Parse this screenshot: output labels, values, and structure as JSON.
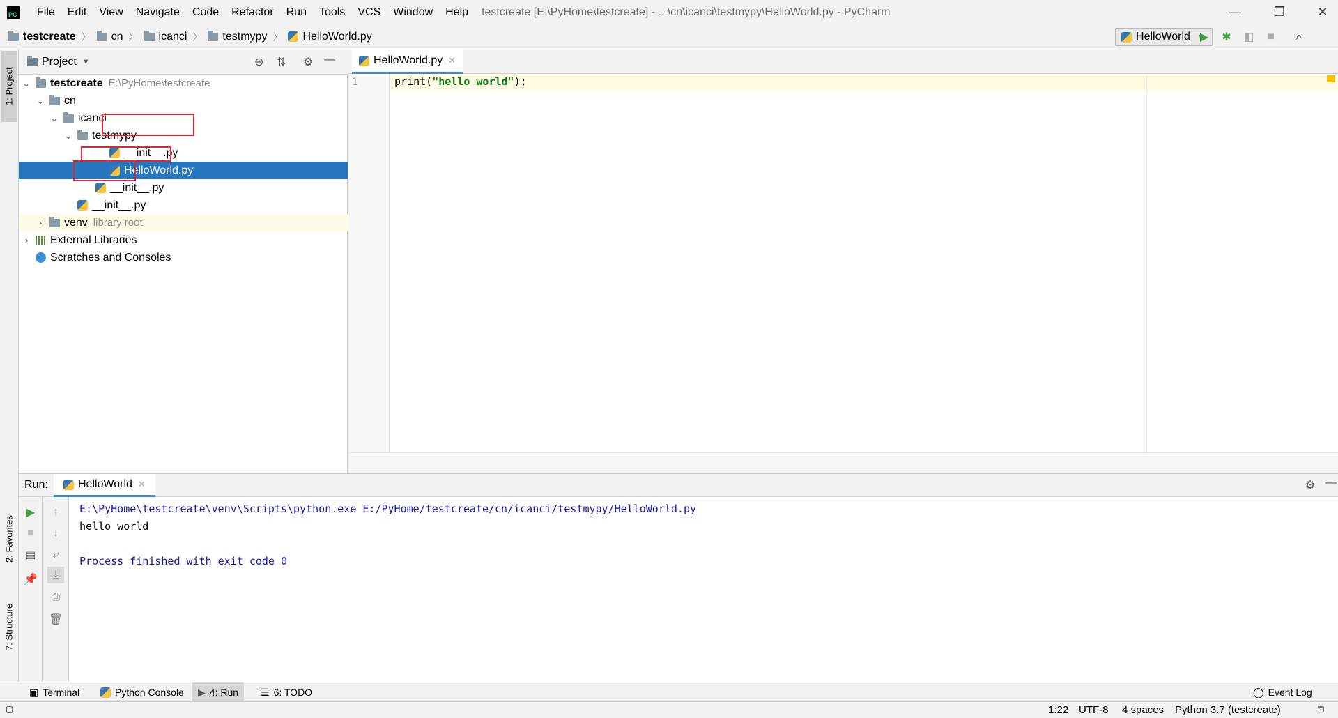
{
  "window": {
    "menu": [
      "File",
      "Edit",
      "View",
      "Navigate",
      "Code",
      "Refactor",
      "Run",
      "Tools",
      "VCS",
      "Window",
      "Help"
    ],
    "title": "testcreate [E:\\PyHome\\testcreate] - ...\\cn\\icanci\\testmypy\\HelloWorld.py - PyCharm",
    "logo_text": "PC"
  },
  "breadcrumb": [
    "testcreate",
    "cn",
    "icanci",
    "testmypy",
    "HelloWorld.py"
  ],
  "run_config": {
    "label": "HelloWorld"
  },
  "left_stripe": {
    "project": "1: Project",
    "favorites": "2: Favorites",
    "structure": "7: Structure"
  },
  "project_panel": {
    "title": "Project",
    "tree": [
      {
        "label": "testcreate",
        "extra": "E:\\PyHome\\testcreate"
      },
      {
        "label": "cn"
      },
      {
        "label": "icanci"
      },
      {
        "label": "testmypy"
      },
      {
        "label": "__init__.py"
      },
      {
        "label": "HelloWorld.py"
      },
      {
        "label": "__init__.py"
      },
      {
        "label": "__init__.py"
      },
      {
        "label": "venv",
        "extra": "library root"
      },
      {
        "label": "External Libraries"
      },
      {
        "label": "Scratches and Consoles"
      }
    ]
  },
  "editor": {
    "tab": "HelloWorld.py",
    "line_number": "1",
    "code_fn": "print(",
    "code_str": "\"hello world\"",
    "code_end": ");"
  },
  "run_panel": {
    "label": "Run:",
    "tab": "HelloWorld",
    "output": [
      "E:\\PyHome\\testcreate\\venv\\Scripts\\python.exe E:/PyHome/testcreate/cn/icanci/testmypy/HelloWorld.py",
      "hello world",
      "Process finished with exit code 0"
    ]
  },
  "bottom_tools": [
    "Terminal",
    "Python Console",
    "4: Run",
    "6: TODO",
    "Event Log"
  ],
  "status": {
    "position": "1:22",
    "encoding": "UTF-8",
    "indent": "4 spaces",
    "interpreter": "Python 3.7 (testcreate)"
  },
  "colors": {
    "selection": "#2675bf",
    "highlight_box": "#e3262b",
    "run_green": "#3fa142",
    "console_blue": "#1a1aa6"
  }
}
